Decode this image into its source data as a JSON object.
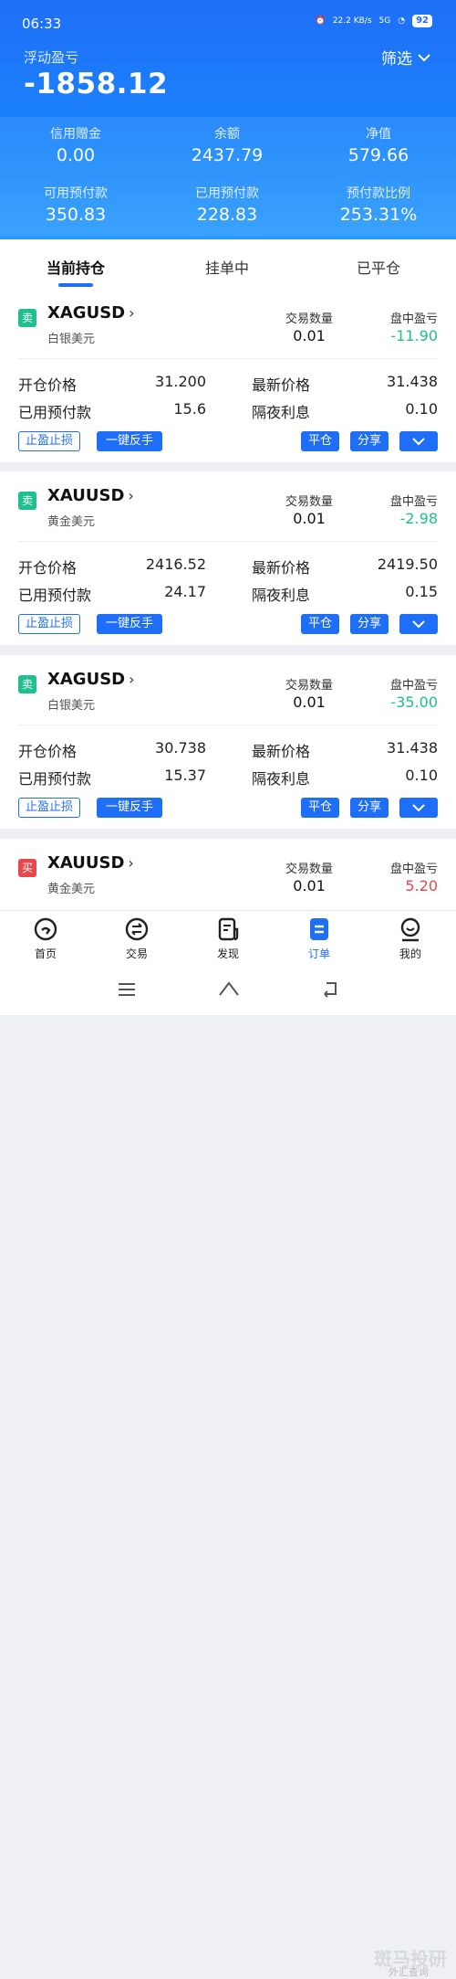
{
  "status_bar": {
    "time": "06:33",
    "net_speed": "22.2 KB/s",
    "signal": "5G",
    "battery": "92"
  },
  "header": {
    "float_label": "浮动盈亏",
    "float_value": "-1858.12",
    "filter_label": "筛选"
  },
  "stats": [
    {
      "label": "信用赠金",
      "value": "0.00"
    },
    {
      "label": "余额",
      "value": "2437.79"
    },
    {
      "label": "净值",
      "value": "579.66"
    },
    {
      "label": "可用预付款",
      "value": "350.83"
    },
    {
      "label": "已用预付款",
      "value": "228.83"
    },
    {
      "label": "预付款比例",
      "value": "253.31%"
    }
  ],
  "tabs": [
    {
      "label": "当前持仓"
    },
    {
      "label": "挂单中"
    },
    {
      "label": "已平仓"
    }
  ],
  "labels": {
    "qty": "交易数量",
    "pl": "盘中盈亏",
    "open_price": "开仓价格",
    "latest_price": "最新价格",
    "used_margin": "已用预付款",
    "swap": "隔夜利息",
    "tp_sl": "止盈止损",
    "reverse": "一键反手",
    "close": "平仓",
    "share": "分享"
  },
  "positions": [
    {
      "side": "卖",
      "symbol": "XAGUSD",
      "name": "白银美元",
      "qty": "0.01",
      "pl": "-11.90",
      "open_price": "31.200",
      "latest_price": "31.438",
      "used_margin": "15.6",
      "swap": "0.10"
    },
    {
      "side": "卖",
      "symbol": "XAUUSD",
      "name": "黄金美元",
      "qty": "0.01",
      "pl": "-2.98",
      "open_price": "2416.52",
      "latest_price": "2419.50",
      "used_margin": "24.17",
      "swap": "0.15"
    },
    {
      "side": "卖",
      "symbol": "XAGUSD",
      "name": "白银美元",
      "qty": "0.01",
      "pl": "-35.00",
      "open_price": "30.738",
      "latest_price": "31.438",
      "used_margin": "15.37",
      "swap": "0.10"
    },
    {
      "side": "买",
      "symbol": "XAUUSD",
      "name": "黄金美元",
      "qty": "0.01",
      "pl": "5.20"
    }
  ],
  "nav": [
    {
      "label": "首页",
      "icon": "home-icon"
    },
    {
      "label": "交易",
      "icon": "trade-icon"
    },
    {
      "label": "发现",
      "icon": "discover-icon"
    },
    {
      "label": "订单",
      "icon": "order-icon"
    },
    {
      "label": "我的",
      "icon": "profile-icon"
    }
  ],
  "watermark": {
    "text": "斑马投研",
    "sub": "外汇查询"
  },
  "colors": {
    "primary": "#1f6ef7",
    "sell": "#1fbf8f",
    "buy": "#e8474c",
    "loss": "#1fbf8f",
    "gain": "#e8474c"
  }
}
